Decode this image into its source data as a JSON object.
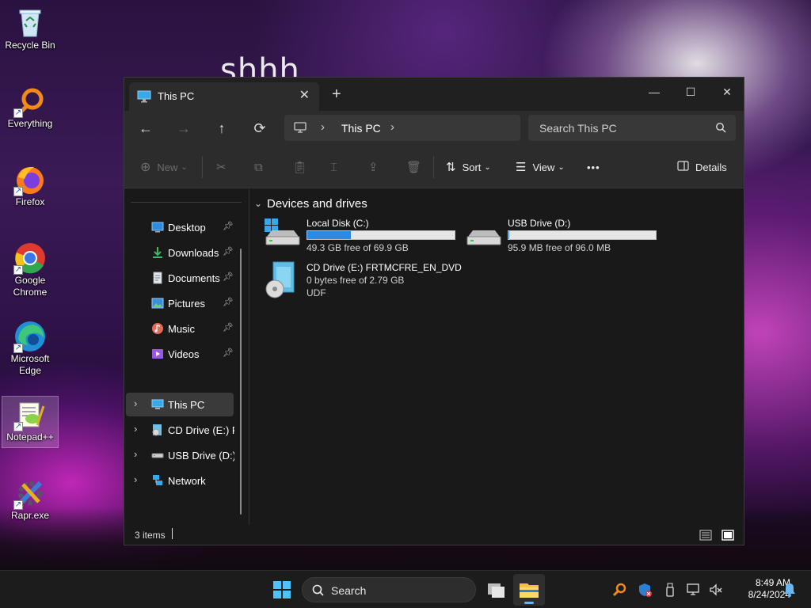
{
  "desktop": {
    "wallpaper_text": "shhh",
    "icons": [
      {
        "label": "Recycle Bin",
        "icon": "recycle-bin-icon"
      },
      {
        "label": "Everything",
        "icon": "everything-icon"
      },
      {
        "label": "Firefox",
        "icon": "firefox-icon"
      },
      {
        "label": "Google Chrome",
        "icon": "chrome-icon"
      },
      {
        "label": "Microsoft Edge",
        "icon": "edge-icon"
      },
      {
        "label": "Notepad++",
        "icon": "notepadpp-icon"
      },
      {
        "label": "Rapr.exe",
        "icon": "rapr-icon"
      }
    ]
  },
  "window": {
    "tab_title": "This PC",
    "tab_close": "✕",
    "new_tab": "+",
    "controls": {
      "minimize": "—",
      "maximize": "☐",
      "close": "✕"
    },
    "address": {
      "back": "←",
      "forward": "→",
      "up": "↑",
      "refresh": "⟳",
      "breadcrumb": "This PC",
      "search_placeholder": "Search This PC"
    },
    "commands": {
      "new": "New",
      "sort": "Sort",
      "view": "View",
      "more": "•••",
      "details": "Details"
    },
    "nav": {
      "quick_access": [
        {
          "label": "Desktop",
          "icon": "desktop-icon"
        },
        {
          "label": "Downloads",
          "icon": "downloads-icon"
        },
        {
          "label": "Documents",
          "icon": "documents-icon"
        },
        {
          "label": "Pictures",
          "icon": "pictures-icon"
        },
        {
          "label": "Music",
          "icon": "music-icon"
        },
        {
          "label": "Videos",
          "icon": "videos-icon"
        }
      ],
      "tree": [
        {
          "label": "This PC",
          "icon": "this-pc-icon"
        },
        {
          "label": "CD Drive (E:) FRTMCFRE_EN_DVD",
          "icon": "cd-drive-icon"
        },
        {
          "label": "USB Drive (D:)",
          "icon": "usb-drive-icon"
        },
        {
          "label": "Network",
          "icon": "network-icon"
        }
      ]
    },
    "content": {
      "group_title": "Devices and drives",
      "drives": [
        {
          "name": "Local Disk (C:)",
          "free_text": "49.3 GB free of 69.9 GB",
          "used_fraction": 0.295,
          "icon": "local-disk-icon"
        },
        {
          "name": "USB Drive (D:)",
          "free_text": "95.9 MB free of 96.0 MB",
          "used_fraction": 0.001,
          "icon": "usb-drive-icon"
        },
        {
          "name": "CD Drive (E:) FRTMCFRE_EN_DVD",
          "free_text": "0 bytes free of 2.79 GB",
          "fs": "UDF",
          "icon": "cd-drive-icon"
        }
      ]
    },
    "status": {
      "item_count": "3 items"
    }
  },
  "taskbar": {
    "search_placeholder": "Search",
    "clock_time": "8:49 AM",
    "clock_date": "8/24/2024",
    "accent": "#6ab6f2"
  }
}
